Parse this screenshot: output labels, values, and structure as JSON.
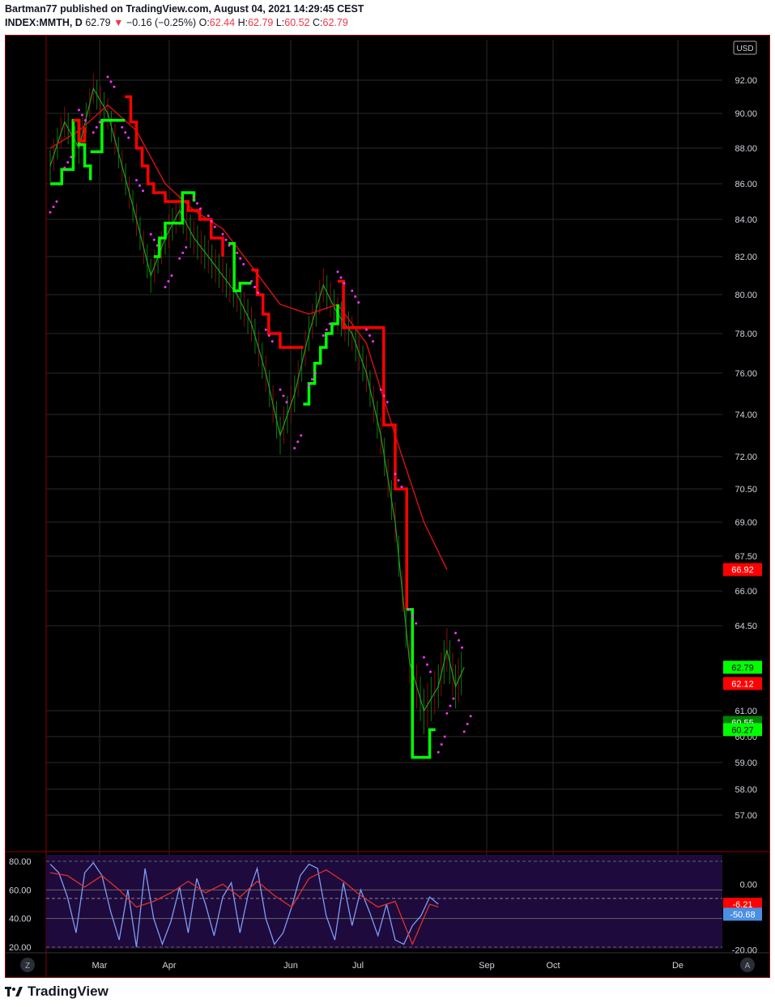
{
  "header": {
    "publisher_line": "Bartman77 published on TradingView.com, August 04, 2021 14:29:45 CEST",
    "symbol": "INDEX:MMTH, D",
    "last": "62.79",
    "change": "−0.16 (−0.25%)",
    "o_label": "O:",
    "o": "62.44",
    "h_label": "H:",
    "h": "62.79",
    "l_label": "L:",
    "l": "60.52",
    "c_label": "C:",
    "c": "62.79"
  },
  "colors": {
    "background": "#000000",
    "up": "#00ff00",
    "down": "#ff0000",
    "psar": "#ff33ff",
    "grid": "#2a2a2a",
    "osc_bg": "#1e0a3c",
    "osc_fast": "#7f9cf5",
    "osc_slow": "#e0302a"
  },
  "chart_data": [
    {
      "type": "line",
      "title": "INDEX:MMTH, D",
      "currency": "USD",
      "y_ticks": [
        "92.00",
        "90.00",
        "88.00",
        "86.00",
        "84.00",
        "82.00",
        "80.00",
        "78.00",
        "76.00",
        "74.00",
        "72.00",
        "70.50",
        "69.00",
        "67.50",
        "66.00",
        "64.50",
        "61.00",
        "60.00",
        "59.00",
        "58.00",
        "57.00"
      ],
      "x_ticks": [
        "Mar",
        "Apr",
        "Jun",
        "Jul",
        "Sep",
        "Oct",
        "De"
      ],
      "price_labels": [
        {
          "text": "66.92",
          "color": "#ff0000"
        },
        {
          "text": "62.79",
          "color": "#00ff00"
        },
        {
          "text": "62.12",
          "color": "#ff0000"
        },
        {
          "text": "60.55",
          "color": "#008000"
        },
        {
          "text": "60.27",
          "color": "#00ff00"
        }
      ],
      "series": [
        {
          "name": "close",
          "x": [
            0,
            5,
            10,
            15,
            20,
            25,
            30,
            35,
            40,
            45,
            50,
            55,
            60,
            65,
            70,
            75,
            80,
            85,
            90,
            95,
            100,
            105,
            110,
            115,
            120,
            125,
            130,
            135,
            138,
            141,
            144
          ],
          "values": [
            87.0,
            89.5,
            88.0,
            91.5,
            90.0,
            87.0,
            84.0,
            81.0,
            83.0,
            84.5,
            83.0,
            82.0,
            81.0,
            80.0,
            78.5,
            76.0,
            73.0,
            75.0,
            78.0,
            80.5,
            79.0,
            78.0,
            76.0,
            73.0,
            69.0,
            63.0,
            61.0,
            62.0,
            63.5,
            62.0,
            62.79
          ]
        },
        {
          "name": "supertrend",
          "segments": [
            {
              "color": "#00ff00",
              "x": [
                0,
                4,
                8,
                10,
                12,
                14
              ],
              "values": [
                86.0,
                86.8,
                89.6,
                88.2,
                87.0,
                86.2
              ]
            },
            {
              "color": "#ff0000",
              "x": [
                8,
                10,
                12
              ],
              "values": [
                89.6,
                88.4,
                89.2
              ]
            },
            {
              "color": "#00ff00",
              "x": [
                14,
                18,
                22,
                26
              ],
              "values": [
                87.8,
                89.6,
                89.6,
                89.6
              ]
            },
            {
              "color": "#ff0000",
              "x": [
                26,
                28,
                30,
                32,
                34,
                36,
                40,
                44,
                48,
                52,
                56,
                60
              ],
              "values": [
                91.0,
                89.5,
                88.0,
                87.0,
                86.0,
                85.5,
                85.0,
                85.0,
                84.5,
                84.0,
                83.0,
                82.0
              ]
            },
            {
              "color": "#00ff00",
              "x": [
                36,
                38,
                40,
                42,
                44,
                46,
                48,
                50
              ],
              "values": [
                82.0,
                83.0,
                83.8,
                83.8,
                83.8,
                85.5,
                85.5,
                85.0
              ]
            },
            {
              "color": "#00ff00",
              "x": [
                62,
                64,
                66,
                68,
                70
              ],
              "values": [
                82.7,
                80.2,
                80.6,
                80.6,
                80.6
              ]
            },
            {
              "color": "#ff0000",
              "x": [
                70,
                72,
                74,
                76,
                80,
                84,
                88
              ],
              "values": [
                81.3,
                80.0,
                79.0,
                78.0,
                77.3,
                77.3,
                77.3
              ]
            },
            {
              "color": "#00ff00",
              "x": [
                88,
                90,
                92,
                94,
                96,
                98,
                100
              ],
              "values": [
                74.5,
                75.5,
                76.5,
                77.3,
                78.0,
                78.5,
                79.5
              ]
            },
            {
              "color": "#ff0000",
              "x": [
                100,
                102,
                106,
                110,
                114,
                116,
                118,
                120,
                122,
                124
              ],
              "values": [
                80.7,
                78.3,
                78.3,
                78.3,
                78.3,
                73.5,
                73.5,
                70.5,
                70.5,
                65.2
              ]
            },
            {
              "color": "#00ff00",
              "x": [
                124,
                126,
                128,
                130,
                132,
                134
              ],
              "values": [
                65.2,
                59.2,
                59.2,
                59.2,
                60.27,
                60.27
              ]
            }
          ]
        },
        {
          "name": "ma",
          "color": "#cc1111",
          "x": [
            0,
            10,
            20,
            30,
            40,
            50,
            60,
            70,
            80,
            90,
            100,
            110,
            120,
            130,
            138
          ],
          "values": [
            88.0,
            89.0,
            90.5,
            89.0,
            86.0,
            84.5,
            83.5,
            81.5,
            79.5,
            79.0,
            79.5,
            77.5,
            73.0,
            69.0,
            66.92
          ]
        }
      ]
    },
    {
      "type": "line",
      "y_ticks": [
        "80.00",
        "60.00",
        "40.00",
        "20.00"
      ],
      "y_ticks_right": [
        "0.00",
        "-20.00"
      ],
      "value_labels": [
        {
          "text": "-6.21",
          "color": "#ff0000"
        },
        {
          "text": "-50.68",
          "color": "#4a90e2"
        }
      ],
      "series": [
        {
          "name": "fast",
          "x": [
            0,
            3,
            6,
            9,
            12,
            15,
            18,
            21,
            24,
            27,
            30,
            33,
            36,
            39,
            42,
            45,
            48,
            51,
            54,
            57,
            60,
            63,
            66,
            69,
            72,
            75,
            78,
            81,
            84,
            87,
            90,
            93,
            96,
            99,
            102,
            105,
            108,
            111,
            114,
            117,
            120,
            123,
            126,
            129,
            132,
            135
          ],
          "values": [
            78,
            72,
            55,
            30,
            72,
            79,
            70,
            45,
            25,
            60,
            20,
            75,
            40,
            22,
            38,
            62,
            30,
            68,
            50,
            28,
            55,
            65,
            30,
            58,
            75,
            40,
            22,
            30,
            48,
            70,
            78,
            75,
            42,
            25,
            65,
            35,
            60,
            45,
            28,
            50,
            25,
            22,
            35,
            42,
            55,
            50
          ]
        },
        {
          "name": "slow",
          "x": [
            0,
            6,
            12,
            18,
            24,
            30,
            36,
            42,
            48,
            54,
            60,
            66,
            72,
            78,
            84,
            90,
            96,
            102,
            108,
            114,
            120,
            126,
            132,
            135
          ],
          "values": [
            72,
            70,
            62,
            70,
            60,
            48,
            52,
            58,
            66,
            58,
            64,
            55,
            66,
            56,
            48,
            68,
            74,
            66,
            56,
            48,
            52,
            22,
            50,
            48
          ]
        }
      ]
    }
  ],
  "footer": {
    "brand": "TradingView"
  },
  "buttons": {
    "z": "Z",
    "a": "A"
  }
}
